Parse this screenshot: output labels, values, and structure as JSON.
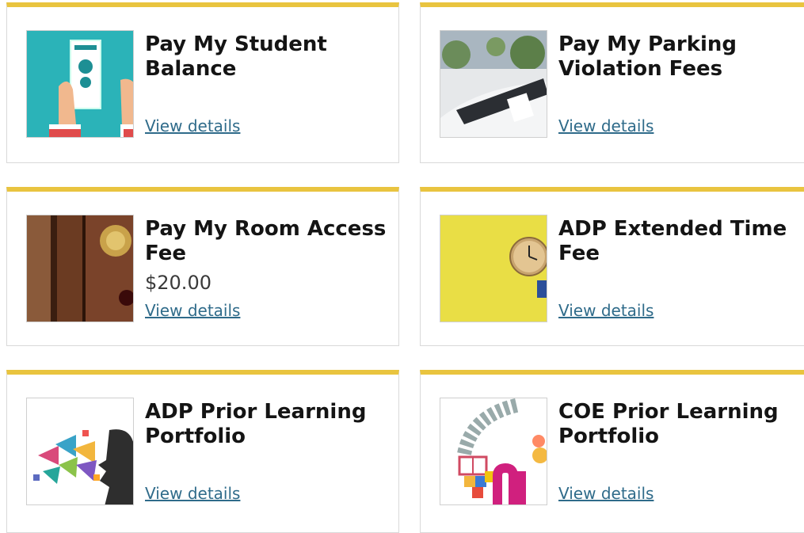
{
  "colors": {
    "accent": "#e9c43f",
    "link": "#2f6b8a"
  },
  "cards": [
    {
      "title": "Pay My Student Balance",
      "price": "",
      "link": "View details",
      "icon": "payment-hand-icon"
    },
    {
      "title": "Pay My Parking Violation Fees",
      "price": "",
      "link": "View details",
      "icon": "parking-ticket-image"
    },
    {
      "title": "Pay My Room Access Fee",
      "price": "$20.00",
      "link": "View details",
      "icon": "door-knob-image"
    },
    {
      "title": "ADP Extended Time Fee",
      "price": "",
      "link": "View details",
      "icon": "clock-image"
    },
    {
      "title": "ADP Prior Learning Portfolio",
      "price": "",
      "link": "View details",
      "icon": "learning-head-image"
    },
    {
      "title": "COE Prior Learning Portfolio",
      "price": "",
      "link": "View details",
      "icon": "education-collage-image"
    }
  ]
}
